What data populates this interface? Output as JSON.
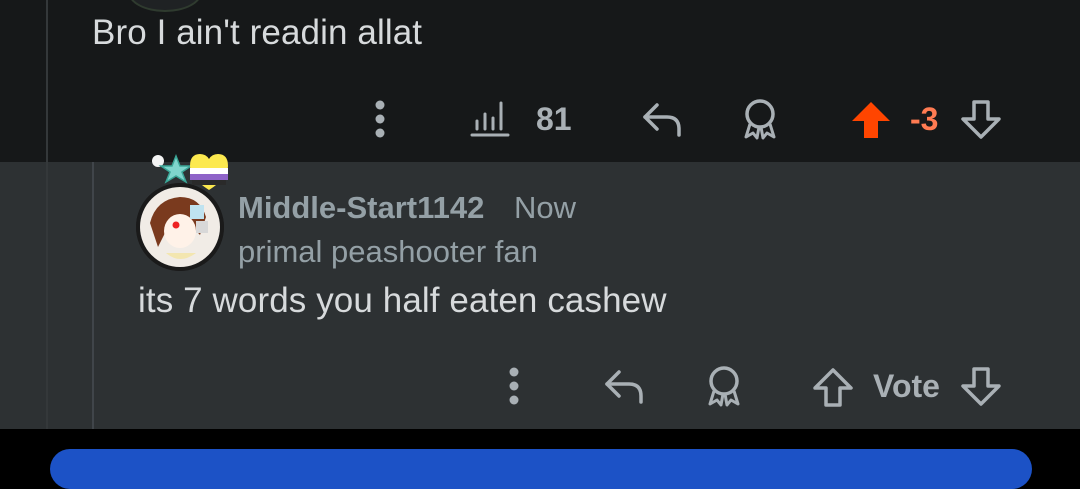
{
  "parent_comment": {
    "text": "Bro I ain't readin allat",
    "actions": {
      "views_icon": "bar-chart-icon",
      "views_count": "81",
      "score": "-3"
    },
    "colors": {
      "upvote_active": "#ff4500",
      "score": "#ff7b52"
    }
  },
  "reply_comment": {
    "username": "Middle-Start1142",
    "timestamp": "Now",
    "flair": "primal peashooter fan",
    "text": "its 7 words you half eaten cashew",
    "vote_label": "Vote"
  },
  "colors": {
    "background_top": "#161819",
    "background_reply": "#2d3133",
    "text": "#d7dadc",
    "muted": "#94a0a6",
    "accent_blue": "#1c52c6"
  }
}
